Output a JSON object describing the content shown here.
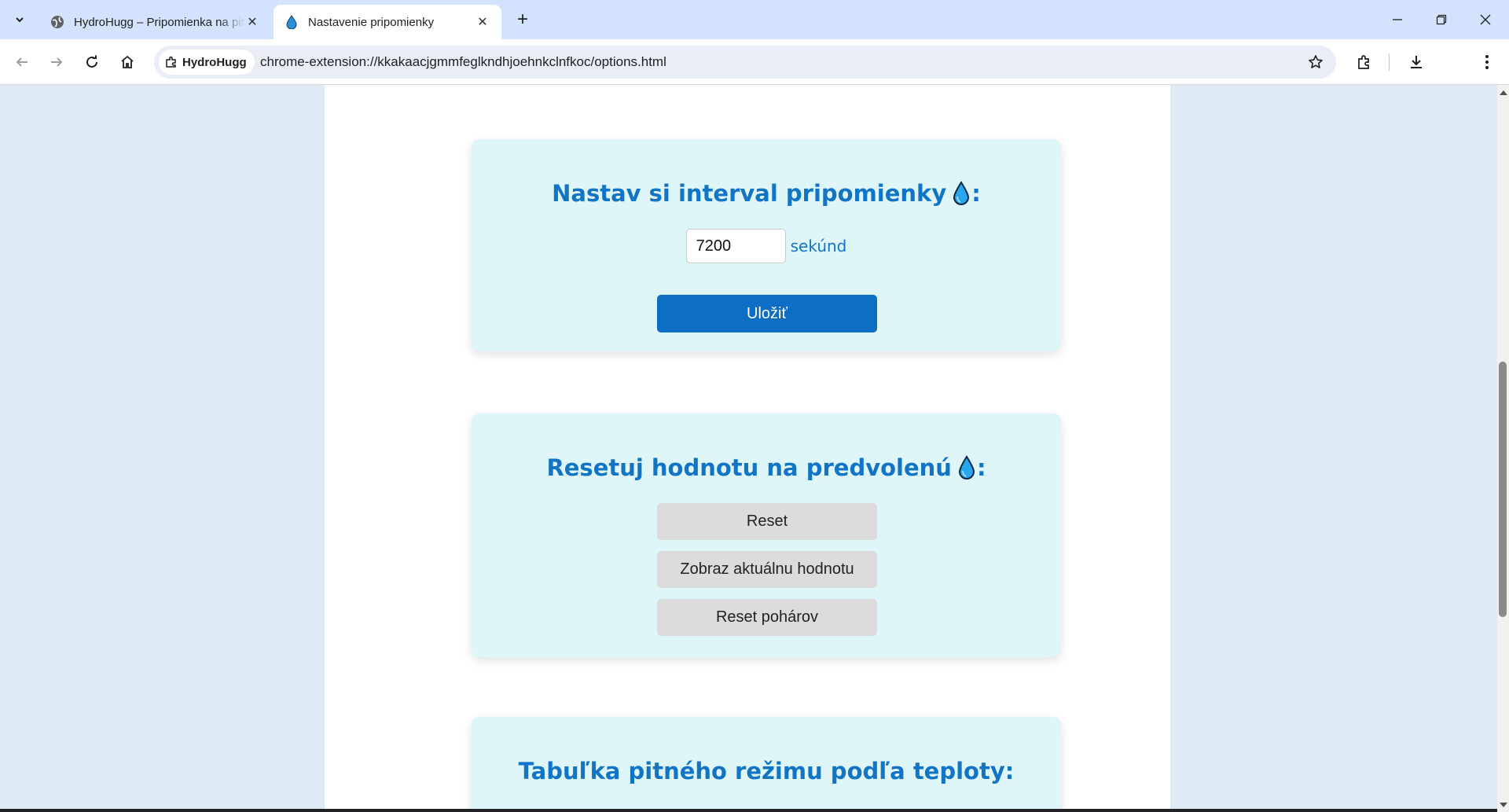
{
  "browser": {
    "tabs": [
      {
        "title": "HydroHugg – Pripomienka na pitie",
        "active": false
      },
      {
        "title": "Nastavenie pripomienky",
        "active": true
      }
    ],
    "site_chip": "HydroHugg",
    "url": "chrome-extension://kkakaacjgmmfeglkndhjoehnkclnfkoc/options.html"
  },
  "interval_card": {
    "title": "Nastav si interval pripomienky",
    "title_suffix": ":",
    "value": "7200",
    "unit": "sekúnd",
    "save_label": "Uložiť"
  },
  "reset_card": {
    "title": "Resetuj hodnotu na predvolenú",
    "title_suffix": ":",
    "reset_label": "Reset",
    "show_label": "Zobraz aktuálnu hodnotu",
    "reset_cups_label": "Reset pohárov"
  },
  "table_card": {
    "title": "Tabuľka pitného režimu podľa teploty:"
  },
  "colors": {
    "accent": "#1274c4",
    "primary_button": "#0d6ec4",
    "card_bg": "#dff6f8"
  }
}
